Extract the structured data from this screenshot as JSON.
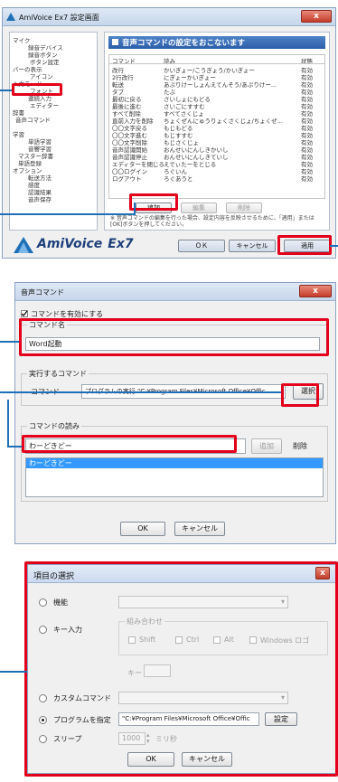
{
  "colors": {
    "highlight": "#e3001b",
    "callout": "#1f6fb6",
    "selected_row": "#3399ff"
  },
  "settings_window": {
    "title": "AmiVoice Ex7 設定画面",
    "close": "x",
    "tree": [
      "マイク",
      "録音デバイス",
      "録音ボタン",
      "ボタン設定",
      "バーの表示",
      "アイコン",
      "入力モード",
      "フォント",
      "連続入力",
      "エディター",
      "辞書",
      "音声コマンド",
      "学習",
      "単語学習",
      "音響学習",
      "マスター辞書",
      "単語登録",
      "オプション",
      "転送方法",
      "感度",
      "認識結果",
      "音声保存"
    ],
    "header": "音声コマンドの設定をおこないます",
    "columns": [
      "コマンド",
      "読み",
      "状態"
    ],
    "rows": [
      [
        "改行",
        "かいぎょー/こうぎょう/かいぎょー",
        "有効"
      ],
      [
        "2行改行",
        "にぎょーかいぎょー",
        "有効"
      ],
      [
        "転送",
        "あぷりけーしょんえてんそう/あぷりけー...",
        "有効"
      ],
      [
        "タブ",
        "たぶ",
        "有効"
      ],
      [
        "最初に戻る",
        "さいしょにもどる",
        "有効"
      ],
      [
        "最後に進む",
        "さいごにすすむ",
        "有効"
      ],
      [
        "すべて削除",
        "すべてさくじょ",
        "有効"
      ],
      [
        "直前入力を削除",
        "ちょくぜんにゅうりょくさくじょ/ちょくぜ...",
        "有効"
      ],
      [
        "〇〇文字戻る",
        "もじもどる",
        "有効"
      ],
      [
        "〇〇文字進む",
        "もじすすむ",
        "有効"
      ],
      [
        "〇〇文字削除",
        "もじさくじょ",
        "有効"
      ],
      [
        "音声認識開始",
        "おんせいにんしきかいし",
        "有効"
      ],
      [
        "音声認識停止",
        "おんせいにんしきていし",
        "有効"
      ],
      [
        "エディターを閉じる",
        "えでぃたーをとじる",
        "有効"
      ],
      [
        "〇〇ログイン",
        "ろぐいん",
        "有効"
      ],
      [
        "ログアウト",
        "ろぐあうと",
        "有効"
      ]
    ],
    "add": "追加",
    "edit": "編集",
    "delete": "削除",
    "note": "※ 音声コマンドの編集を行った場合、設定内容を反映させるために、「適用」または[OK]ボタンを押してください。",
    "logo_main": "AmiVoice",
    "logo_ex": "Ex7",
    "ok": "ＯＫ",
    "cancel": "キャンセル",
    "apply": "適用"
  },
  "cmd_dialog": {
    "title": "音声コマンド",
    "close": "x",
    "enable_label": "コマンドを有効にする",
    "name_group": "コマンド名",
    "name_value": "Word起動",
    "exec_group": "実行するコマンド",
    "exec_label": "コマンド",
    "exec_value": "プログラムの実行 \"C:¥Program Files¥Microsoft Office¥Offic",
    "select": "選択",
    "reading_group": "コマンドの読み",
    "reading_value": "わーどきどー",
    "add": "追加",
    "delete": "削除",
    "list_item": "わーどきどー",
    "ok": "OK",
    "cancel": "キャンセル"
  },
  "item_dialog": {
    "title": "項目の選択",
    "close": "x",
    "function": "機能",
    "key_input": "キー入力",
    "combo_group": "組み合わせ",
    "mods": [
      "Shift",
      "Ctrl",
      "Alt",
      "Windows ロゴ"
    ],
    "key_label": "キー",
    "custom": "カスタムコマンド",
    "program": "プログラムを指定",
    "program_value": "\"C:¥Program Files¥Microsoft Office¥Offic",
    "settings": "設定",
    "sleep": "スリープ",
    "sleep_value": "1000",
    "ms": "ミリ秒",
    "ok": "OK",
    "cancel": "キャンセル"
  }
}
